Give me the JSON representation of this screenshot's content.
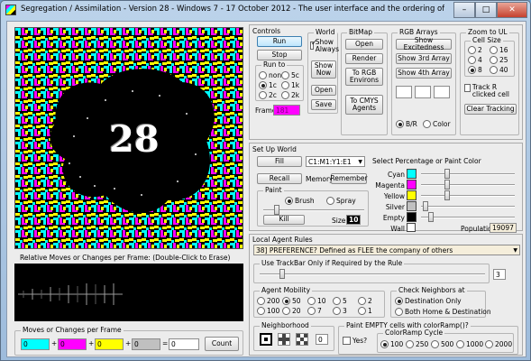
{
  "window": {
    "title": "Segregation / Assimilation - Version 28 - Windows 7 - 17 October 2012 - The user interface and the ordering of rules has been simplified...",
    "min": "–",
    "max": "□",
    "close": "✕"
  },
  "canvas": {
    "overlay_number": "28",
    "pattern_colors": [
      "#00ffff",
      "#ff00ff",
      "#ffff00",
      "#000000"
    ]
  },
  "graph": {
    "label": "Relative Moves or Changes per Frame:  (Double-Click to Erase)"
  },
  "moves": {
    "title": "Moves or Changes per Frame",
    "values": [
      "0",
      "0",
      "0",
      "0"
    ],
    "total": "0",
    "plus": "+",
    "equals": "=",
    "count_button": "Count"
  },
  "controls": {
    "title": "Controls",
    "run": "Run",
    "stop": "Stop",
    "run_to": {
      "title": "Run to",
      "options": [
        "none",
        "5c",
        "1c",
        "1k",
        "2c",
        "2k"
      ],
      "selected": "1c"
    },
    "frame_label": "Frame",
    "frame_value": "181",
    "world": {
      "title": "World",
      "show_always": "Show Always",
      "show_now": "Show Now",
      "open": "Open",
      "save": "Save"
    },
    "bitmap": {
      "title": "BitMap",
      "open": "Open",
      "render": "Render",
      "to_rgb": "To RGB Environs",
      "to_cmys": "To CMYS Agents"
    },
    "rgb": {
      "title": "RGB Arrays",
      "excitedness": "Show Excitedness",
      "third": "Show 3rd Array",
      "fourth": "Show 4th Array",
      "mode_a": "B/R",
      "mode_b": "Color"
    },
    "zoom": {
      "title": "Zoom to UL",
      "cell_size": "Cell Size",
      "options": [
        "2",
        "16",
        "4",
        "25",
        "8",
        "40"
      ],
      "selected": "8",
      "track_r": "Track R clicked cell",
      "clear": "Clear Tracking"
    }
  },
  "setup": {
    "title": "Set Up World",
    "fill": "Fill",
    "range": "C1:M1:Y1:E1",
    "recall": "Recall",
    "memory": "Memory",
    "remember": "Remember",
    "paint": {
      "title": "Paint",
      "brush": "Brush",
      "spray": "Spray",
      "kill": "Kill",
      "size_label": "Size",
      "size_value": "10"
    },
    "pct_label": "Select Percentage or Paint Color",
    "colors": [
      {
        "name": "Cyan",
        "swatch": "#00ffff"
      },
      {
        "name": "Magenta",
        "swatch": "#ff00ff"
      },
      {
        "name": "Yellow",
        "swatch": "#ffff00"
      },
      {
        "name": "Silver",
        "swatch": "#c0c0c0"
      },
      {
        "name": "Empty",
        "swatch": "#000000"
      },
      {
        "name": "Wall",
        "swatch": "#ffffff"
      }
    ],
    "population_label": "Population",
    "population_value": "19097"
  },
  "rules": {
    "title": "Local Agent Rules",
    "rule": "38] PREFERENCE?  Defined as FLEE the company of others",
    "trackbar_label": "Use TrackBar Only if Required by the Rule",
    "trackbar_value": "3",
    "mobility": {
      "title": "Agent Mobility",
      "options": [
        "200",
        "50",
        "10",
        "5",
        "2",
        "100",
        "20",
        "7",
        "3",
        "1"
      ],
      "selected": "50"
    },
    "neighbors": {
      "title": "Check Neighbors at",
      "dest_only": "Destination Only",
      "both": "Both Home & Destination"
    },
    "neighborhood": {
      "title": "Neighborhood",
      "value": "0"
    },
    "paint_empty": {
      "title": "Paint EMPTY cells with colorRamp()?",
      "yes": "Yes?",
      "ramp_title": "ColorRamp Cycle",
      "options": [
        "100",
        "250",
        "500",
        "1000",
        "2000"
      ],
      "selected": "100"
    }
  }
}
